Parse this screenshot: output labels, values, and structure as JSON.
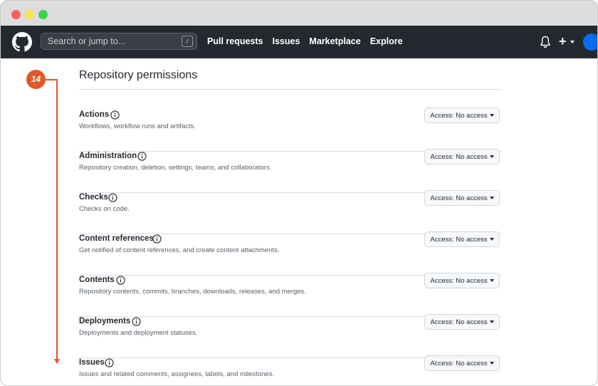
{
  "header": {
    "search_placeholder": "Search or jump to...",
    "search_shortcut": "/",
    "nav": [
      "Pull requests",
      "Issues",
      "Marketplace",
      "Explore"
    ],
    "plus_label": "+"
  },
  "annotation": {
    "step_number": "14"
  },
  "section_title": "Repository permissions",
  "permissions": [
    {
      "name": "Actions",
      "description": "Workflows, workflow runs and artifacts.",
      "access": "Access: No access"
    },
    {
      "name": "Administration",
      "description": "Repository creation, deletion, settings, teams, and collaborators.",
      "access": "Access: No access"
    },
    {
      "name": "Checks",
      "description": "Checks on code.",
      "access": "Access: No access"
    },
    {
      "name": "Content references",
      "description": "Get notified of content references, and create content attachments.",
      "access": "Access: No access"
    },
    {
      "name": "Contents",
      "description": "Repository contents, commits, branches, downloads, releases, and merges.",
      "access": "Access: No access"
    },
    {
      "name": "Deployments",
      "description": "Deployments and deployment statuses.",
      "access": "Access: No access"
    },
    {
      "name": "Issues",
      "description": "Issues and related comments, assignees, labels, and milestones.",
      "access": "Access: No access"
    }
  ],
  "colors": {
    "header_bg": "#24292f",
    "annotation": "#e3582a",
    "avatar": "#0a6cf0"
  }
}
